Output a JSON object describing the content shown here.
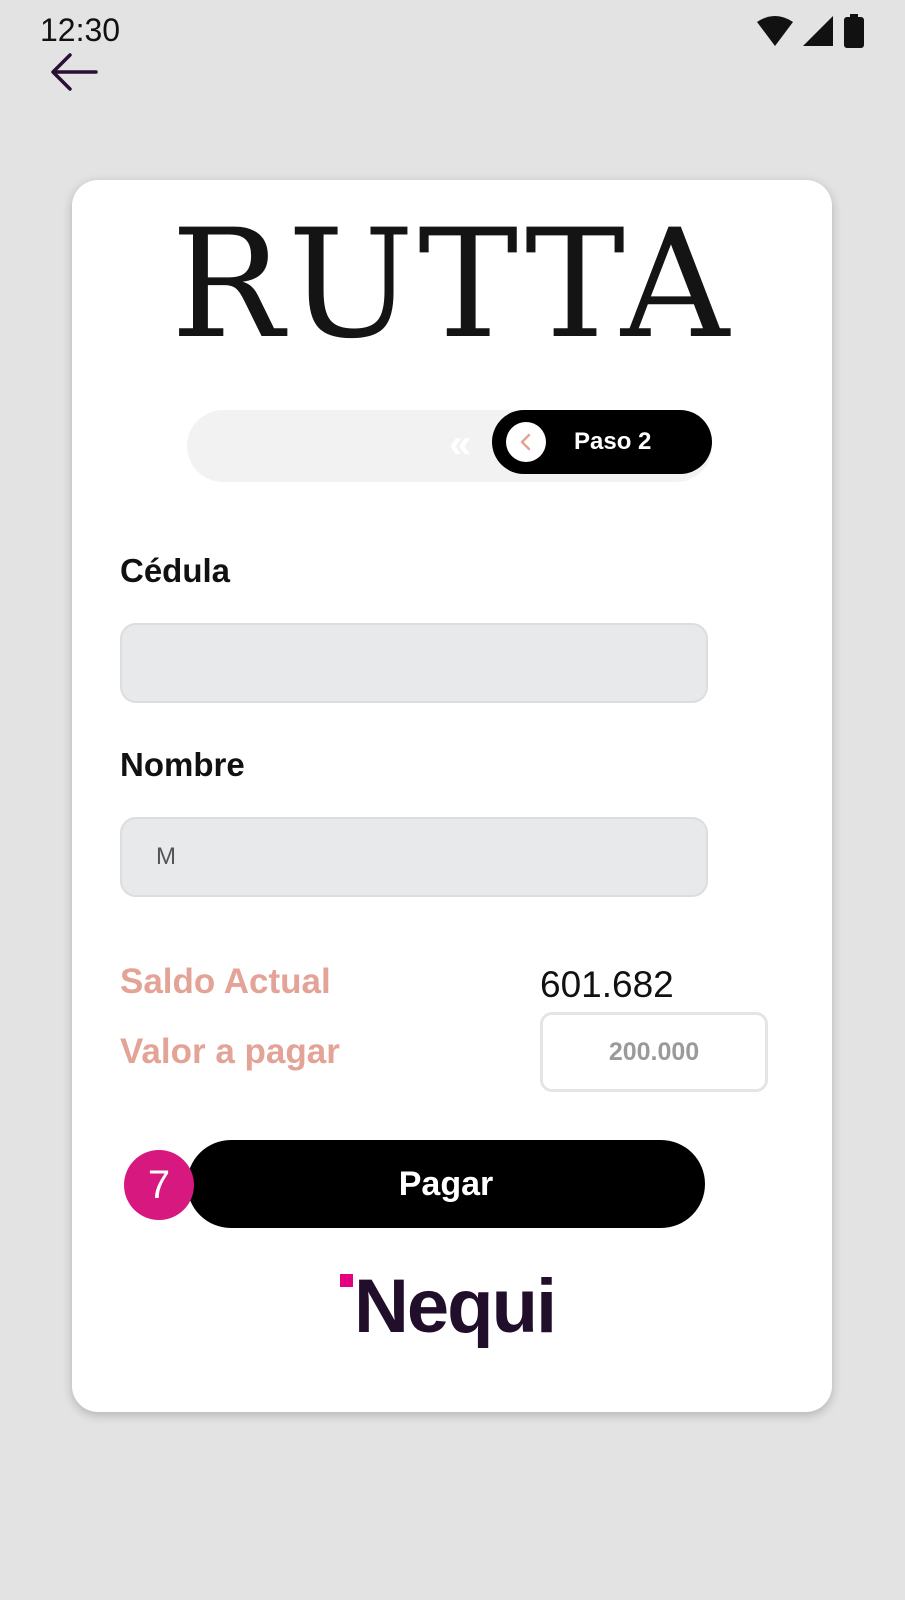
{
  "status_bar": {
    "time": "12:30"
  },
  "card": {
    "brand": "RUTTA",
    "step": {
      "label": "Paso 2",
      "chevrons": "«"
    },
    "fields": {
      "cedula": {
        "label": "Cédula",
        "value": ""
      },
      "nombre": {
        "label": "Nombre",
        "value": "M"
      }
    },
    "balance": {
      "label": "Saldo Actual",
      "value": "601.682"
    },
    "amount": {
      "label": "Valor a pagar",
      "placeholder": "200.000"
    },
    "pay_button": {
      "label": "Pagar",
      "badge": "7"
    },
    "footer_brand": "Nequi"
  },
  "colors": {
    "accent_pink": "#d6187f",
    "label_salmon": "#e3a396",
    "nequi_purple": "#200e2a",
    "nequi_magenta": "#e5007e"
  },
  "icons": [
    "wifi-icon",
    "signal-icon",
    "battery-icon",
    "back-arrow-icon",
    "chevron-left-icon",
    "double-chevron-icon"
  ]
}
